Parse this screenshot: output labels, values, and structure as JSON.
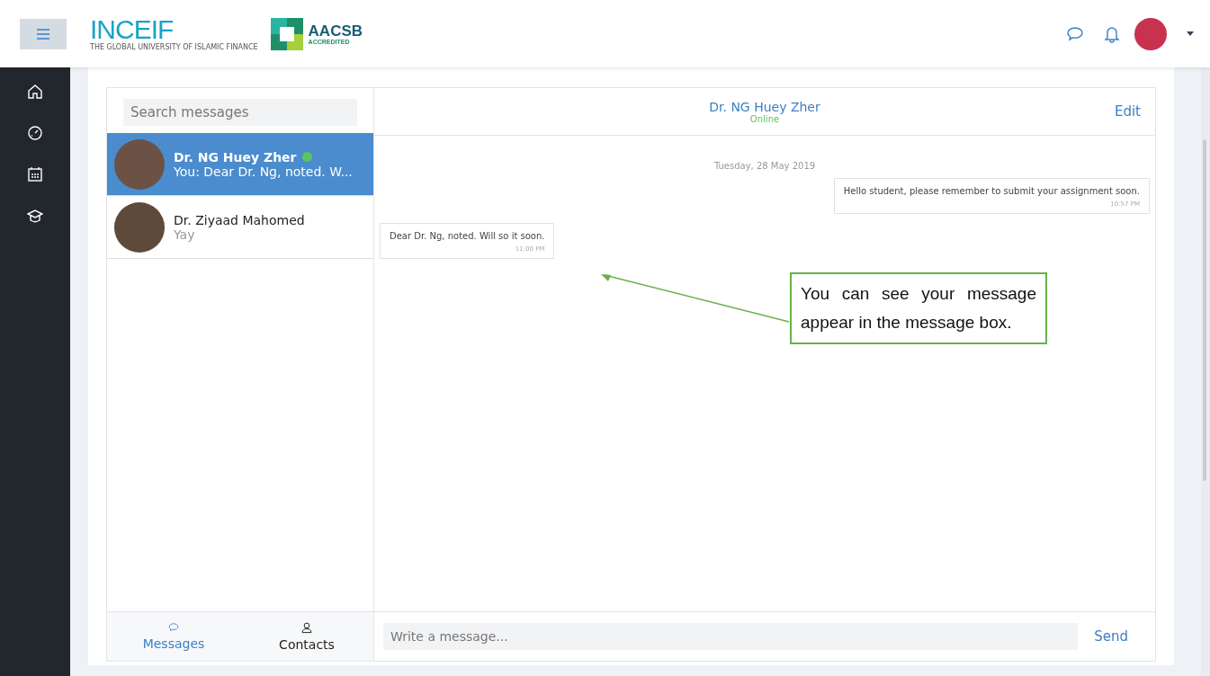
{
  "header": {
    "logo": {
      "name": "INCEIF",
      "tagline": "THE GLOBAL UNIVERSITY OF ISLAMIC FINANCE"
    },
    "accreditation": {
      "name": "AACSB",
      "sub": "ACCREDITED"
    }
  },
  "sidebar": {
    "items": [
      {
        "kind": "home"
      },
      {
        "kind": "dashboard"
      },
      {
        "kind": "calendar"
      },
      {
        "kind": "courses"
      }
    ]
  },
  "search": {
    "placeholder": "Search messages"
  },
  "conversations": [
    {
      "name": "Dr. NG Huey Zher",
      "preview": "You: Dear Dr. Ng, noted. W...",
      "online": true,
      "selected": true
    },
    {
      "name": "Dr. Ziyaad Mahomed",
      "preview": "Yay",
      "online": false,
      "selected": false
    }
  ],
  "tabs": [
    {
      "label": "Messages",
      "kind": "messages",
      "selected": true
    },
    {
      "label": "Contacts",
      "kind": "contacts",
      "selected": false
    }
  ],
  "chat": {
    "name": "Dr. NG Huey Zher",
    "status": "Online",
    "edit": "Edit",
    "date": "Tuesday, 28 May 2019",
    "messages": [
      {
        "text": "Hello student, please remember to submit your assignment soon.",
        "time": "10:57 PM",
        "from_me": false
      },
      {
        "text": "Dear Dr. Ng, noted. Will so it soon.",
        "time": "11:00 PM",
        "from_me": true
      }
    ]
  },
  "composer": {
    "placeholder": "Write a message...",
    "send": "Send"
  },
  "callout": {
    "text": "You can see your message appear in the message box."
  }
}
